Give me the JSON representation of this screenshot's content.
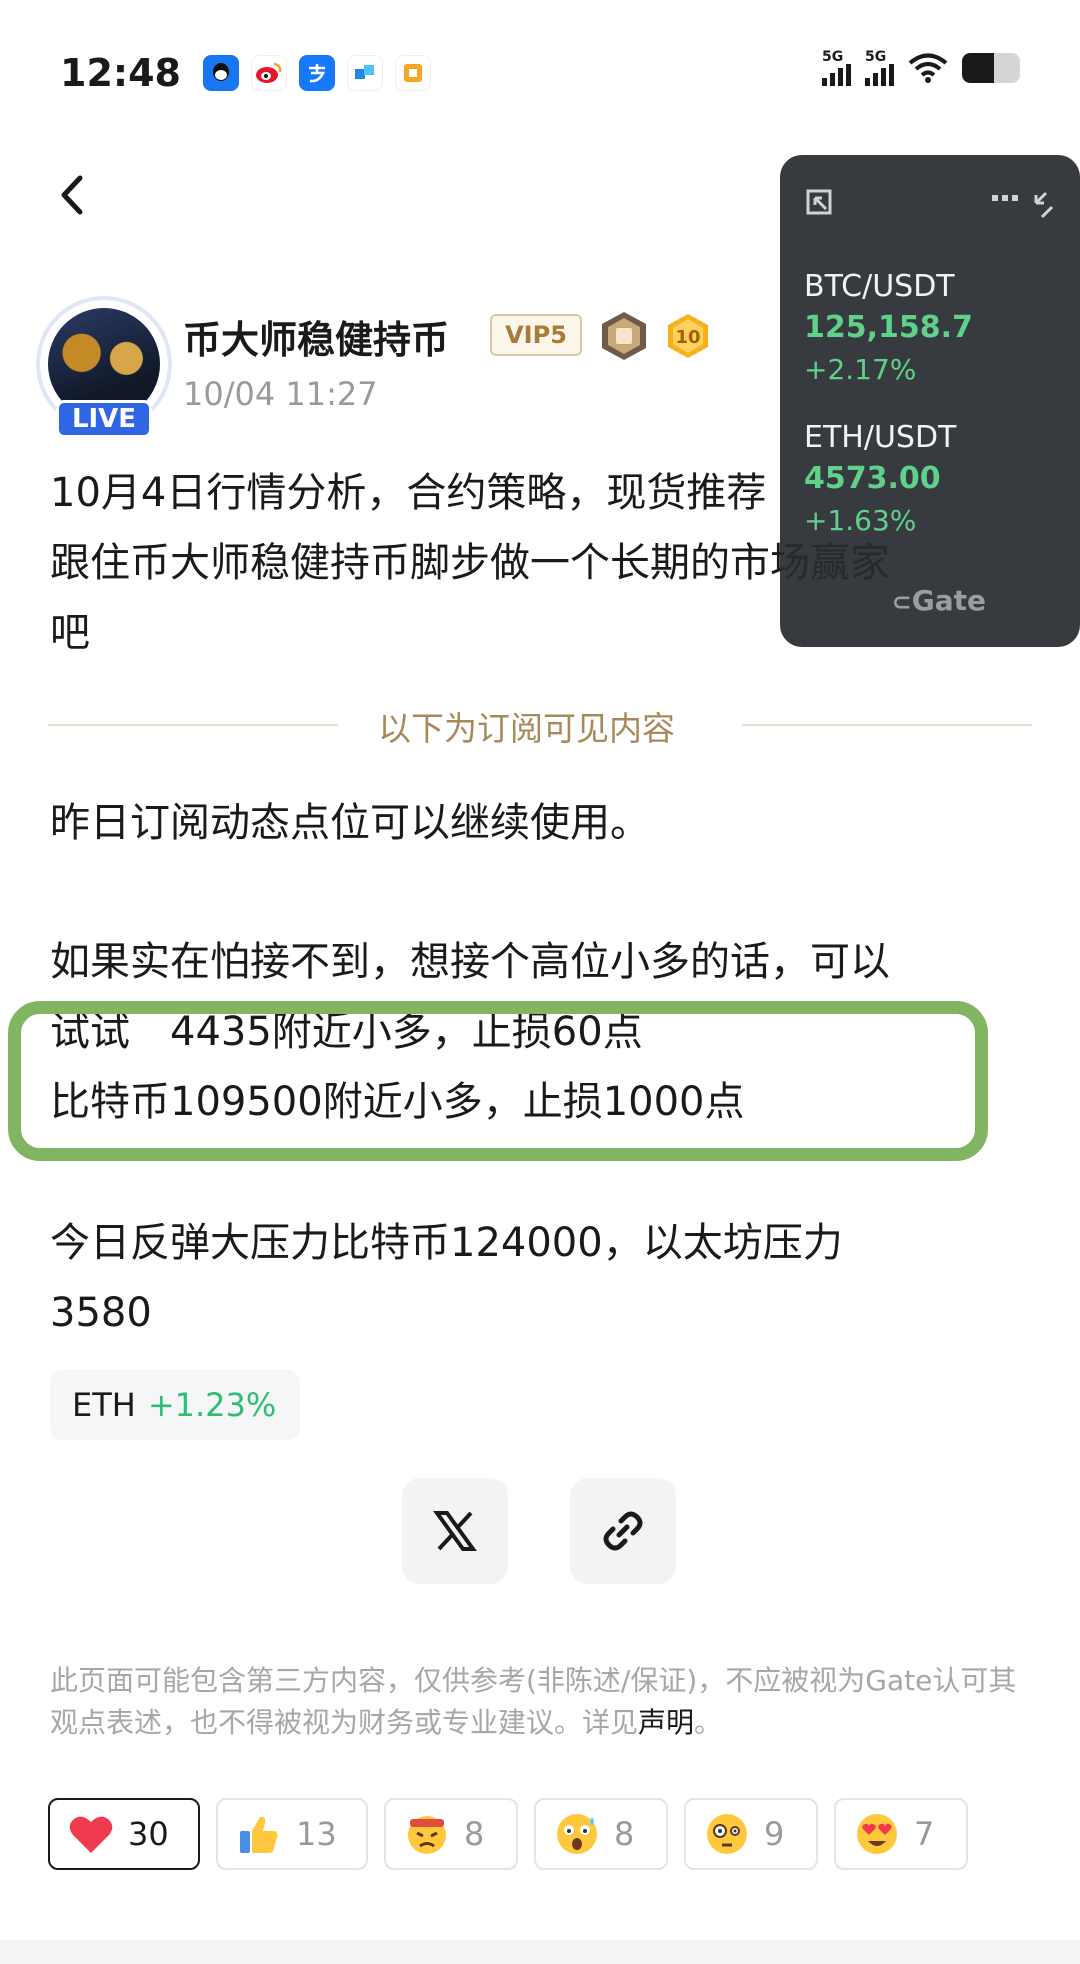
{
  "status_bar": {
    "time": "12:48",
    "signal_1": "5G",
    "signal_2": "5G"
  },
  "ticker": {
    "pairs": [
      {
        "symbol": "BTC/USDT",
        "price": "125,158.7",
        "change": "+2.17%"
      },
      {
        "symbol": "ETH/USDT",
        "price": "4573.00",
        "change": "+1.63%"
      }
    ],
    "brand": "Gate",
    "colors": {
      "up": "#5fd18b",
      "background": "#2c3034"
    }
  },
  "author": {
    "name": "币大师稳健持币",
    "vip": "VIP5",
    "level": "10",
    "live": "LIVE",
    "time": "10/04 11:27"
  },
  "post": {
    "line1": "10月4日行情分析，合约策略，现货推荐",
    "line2": "跟住币大师稳健持币脚步做一个长期的市场赢家",
    "line3": "吧",
    "divider": "以下为订阅可见内容",
    "p1": "昨日订阅动态点位可以继续使用。",
    "p2": "如果实在怕接不到，想接个高位小多的话，可以",
    "p3": "试试　4435附近小多，止损60点",
    "p4": "比特币109500附近小多，止损1000点",
    "p5": "今日反弹大压力比特币124000，以太坊压力",
    "p6": "3580"
  },
  "coin_tag": {
    "symbol": "ETH",
    "change": "+1.23%"
  },
  "disclaimer": {
    "text": "此页面可能包含第三方内容，仅供参考(非陈述/保证)，不应被视为Gate认可其观点表述，也不得被视为财务或专业建议。详见",
    "link": "声明",
    "end": "。"
  },
  "reactions": [
    {
      "icon": "heart-icon",
      "count": "30"
    },
    {
      "icon": "thumbs-up-icon",
      "count": "13"
    },
    {
      "icon": "angry-emoji-icon",
      "count": "8"
    },
    {
      "icon": "shocked-emoji-icon",
      "count": "8"
    },
    {
      "icon": "thinking-emoji-icon",
      "count": "9"
    },
    {
      "icon": "heart-eyes-emoji-icon",
      "count": "7"
    }
  ],
  "highlight_color": "#82b562"
}
